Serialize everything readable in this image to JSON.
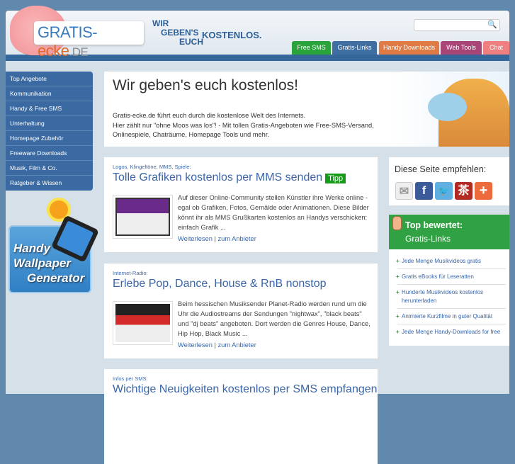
{
  "header": {
    "logo": {
      "main": "GRATIS-",
      "accent": "ecke",
      "suffix": ".DE"
    },
    "slogan": {
      "line1": "WIR",
      "line2": "GEBEN'S",
      "line3": "EUCH",
      "line4": "KOSTENLOS."
    },
    "search_placeholder": "",
    "search_icon": "🔍"
  },
  "tabs": [
    {
      "label": "Free SMS",
      "color": "#2aa33b"
    },
    {
      "label": "Gratis-Links",
      "color": "#3e6ea2"
    },
    {
      "label": "Handy Downloads",
      "color": "#e07b45"
    },
    {
      "label": "Web Tools",
      "color": "#a94477"
    },
    {
      "label": "Chat",
      "color": "#f08080"
    }
  ],
  "sidebar": {
    "items": [
      "Top Angebote",
      "Kommunikation",
      "Handy & Free SMS",
      "Unterhaltung",
      "Homepage Zubehör",
      "Freeware Downloads",
      "Musik, Film & Co.",
      "Ratgeber & Wissen"
    ],
    "banner": {
      "line1": "Handy",
      "line2": "Wallpaper",
      "line3": "Generator"
    }
  },
  "intro": {
    "title": "Wir geben's euch kostenlos!",
    "line1": "Gratis-ecke.de führt euch durch die kostenlose Welt des Internets.",
    "line2": "Hier zählt nur \"ohne Moos was los\"! - Mit tollen Gratis-Angeboten wie Free-SMS-Versand, Onlinespiele, Chaträume, Homepage Tools und mehr."
  },
  "articles": [
    {
      "category": "Logos, Klingeltöne, MMS, Spiele:",
      "title": "Tolle Grafiken kostenlos per MMS senden",
      "badge": "Tipp",
      "text": "Auf dieser Online-Community stellen Künstler ihre Werke online - egal ob Grafiken, Fotos, Gemälde oder Animationen. Diese Bilder könnt ihr als MMS Grußkarten kostenlos an Handys verschicken: einfach Grafik ...",
      "more": "Weiterlesen",
      "sep": "|",
      "provider": "zum Anbieter"
    },
    {
      "category": "Internet-Radio:",
      "title": "Erlebe Pop, Dance, House & RnB nonstop",
      "text": "Beim hessischen Musiksender Planet-Radio werden rund um die Uhr die Audiostreams der Sendungen \"nightwax\", \"black beats\" und \"dj beats\" angeboten. Dort werden die Genres House, Dance, Hip Hop, Black Music ...",
      "more": "Weiterlesen",
      "sep": "|",
      "provider": "zum Anbieter"
    },
    {
      "category": "Infos per SMS:",
      "title": "Wichtige Neuigkeiten kostenlos per SMS empfangen"
    }
  ],
  "recommend": {
    "title": "Diese Seite empfehlen:"
  },
  "top": {
    "title": "Top bewertet:",
    "subtitle": "Gratis-Links",
    "items": [
      "Jede Menge Musikvideos gratis",
      "Gratis eBooks für Leseratten",
      "Hunderte Musikvideos kostenlos herunterladen",
      "Animierte Kurzfilme in guter Qualität",
      "Jede Menge Handy-Downloads for free"
    ]
  }
}
